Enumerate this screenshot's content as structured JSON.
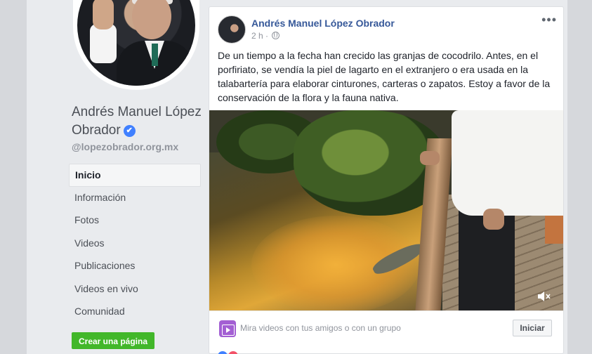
{
  "page": {
    "name": "Andrés Manuel López Obrador",
    "handle": "@lopezobrador.org.mx",
    "verified_mark": "✔"
  },
  "nav": {
    "items": [
      {
        "label": "Inicio",
        "active": true
      },
      {
        "label": "Información"
      },
      {
        "label": "Fotos"
      },
      {
        "label": "Videos"
      },
      {
        "label": "Publicaciones"
      },
      {
        "label": "Videos en vivo"
      },
      {
        "label": "Comunidad"
      }
    ],
    "create_page_label": "Crear una página"
  },
  "post": {
    "author": "Andrés Manuel López Obrador",
    "time": "2 h ·",
    "more_label": "•••",
    "text": "De un tiempo a la fecha han crecido las granjas de cocodrilo. Antes, en el porfiriato, se vendía la piel de lagarto en el extranjero o era usada en la talabartería para elaborar cinturones, carteras o zapatos. Estoy a favor de la conservación de la flora y la fauna nativa.",
    "video_muted": true
  },
  "watch_party": {
    "text": "Mira videos con tus amigos o con un grupo",
    "button_label": "Iniciar",
    "icon_color": "#a35fd3"
  },
  "colors": {
    "link": "#365899",
    "verified": "#4080ff",
    "create_button": "#42b72a",
    "background": "#e9ebee"
  }
}
